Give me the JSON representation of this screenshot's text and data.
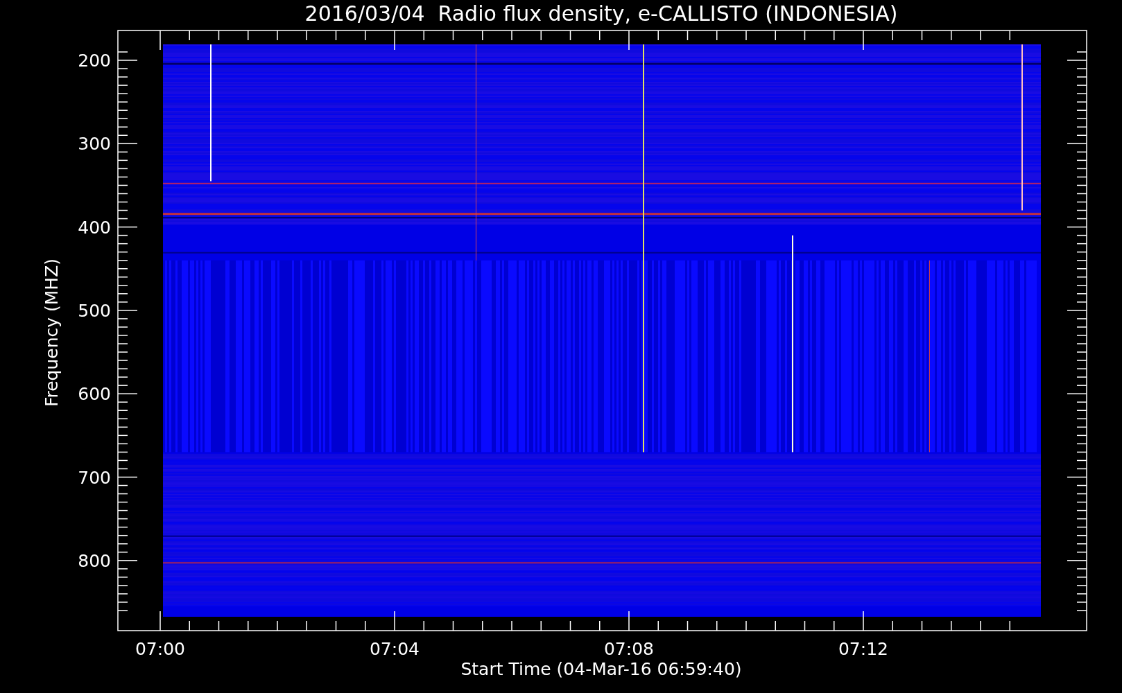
{
  "title": "2016/03/04  Radio flux density, e-CALLISTO (INDONESIA)",
  "y_axis": {
    "label": "Frequency (MHZ)",
    "ticks": [
      "200",
      "300",
      "400",
      "500",
      "600",
      "700",
      "800"
    ]
  },
  "x_axis": {
    "label": "Start Time (04-Mar-16 06:59:40)",
    "ticks": [
      "07:00",
      "07:04",
      "07:08",
      "07:12"
    ]
  }
}
